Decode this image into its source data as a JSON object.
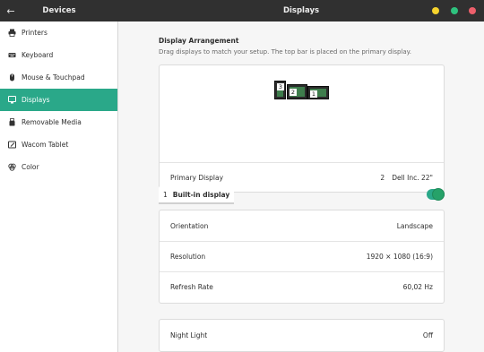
{
  "titlebar": {
    "left_title": "Devices",
    "title": "Displays",
    "back_icon": "arrow-left-icon",
    "buttons": {
      "minimize_color": "#f6d32d",
      "maximize_color": "#2ec27e",
      "close_color": "#ed5f6b"
    }
  },
  "sidebar": {
    "accent": "#2aa889",
    "items": [
      {
        "label": "Printers",
        "icon": "printer-icon",
        "active": false
      },
      {
        "label": "Keyboard",
        "icon": "keyboard-icon",
        "active": false
      },
      {
        "label": "Mouse & Touchpad",
        "icon": "mouse-icon",
        "active": false
      },
      {
        "label": "Displays",
        "icon": "display-icon",
        "active": true
      },
      {
        "label": "Removable Media",
        "icon": "usb-drive-icon",
        "active": false
      },
      {
        "label": "Wacom Tablet",
        "icon": "tablet-icon",
        "active": false
      },
      {
        "label": "Color",
        "icon": "color-palette-icon",
        "active": false
      }
    ]
  },
  "arrangement": {
    "title": "Display Arrangement",
    "subtitle": "Drag displays to match your setup. The top bar is placed on the primary display.",
    "monitors": [
      {
        "number": "3"
      },
      {
        "number": "2"
      },
      {
        "number": "1"
      }
    ],
    "primary_label": "Primary Display",
    "primary_number": "2",
    "primary_name": "Dell Inc. 22\""
  },
  "display": {
    "number": "1",
    "name": "Built-in display",
    "enabled": true
  },
  "settings": {
    "orientation_label": "Orientation",
    "orientation_value": "Landscape",
    "resolution_label": "Resolution",
    "resolution_value": "1920 × 1080 (16:9)",
    "refresh_label": "Refresh Rate",
    "refresh_value": "60,02 Hz"
  },
  "night_light": {
    "label": "Night Light",
    "value": "Off"
  }
}
